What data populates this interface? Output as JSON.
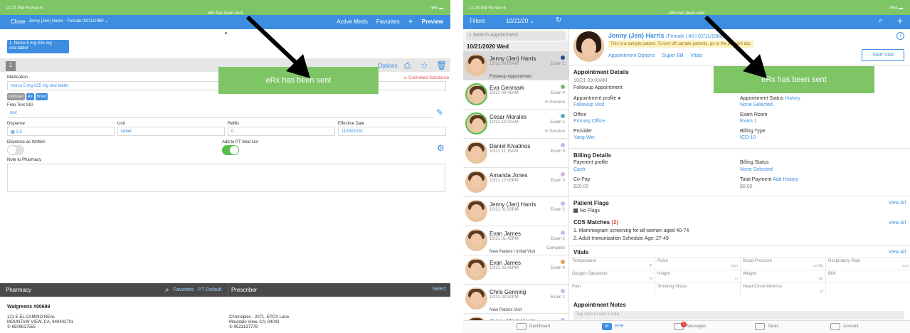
{
  "left": {
    "status": {
      "time": "12:21 PM  Fri Nov 6",
      "center": "eRx has been sent",
      "battery": "76%"
    },
    "nav": {
      "close": "Close",
      "patient": "Jenny (Jen) Harris - Female 02/11/1980",
      "active_meds": "Active Meds",
      "favorites": "Favorites",
      "plus": "+",
      "preview": "Preview"
    },
    "med_chip": {
      "line1": "1. Norco 5 mg-325 mg",
      "line2": "oral tablet"
    },
    "row_number": "1",
    "options": "Options",
    "medication_label": "Medication",
    "controlled": "Controlled Substance",
    "medication_value": "Norco 5 mg-325 mg oral tablet",
    "tags": [
      "Unknown",
      "RX",
      "Brand"
    ],
    "sig_label": "Free Text SIG",
    "sig_value": "test",
    "dispense_label": "Dispense",
    "dispense_value": "1.0",
    "unit_label": "Unit",
    "unit_value": "tablet",
    "refills_label": "Refills",
    "refills_value": "0",
    "effective_label": "Effective Date",
    "effective_value": "11/06/2020",
    "daw_label": "Dispense as Written",
    "daw_on": false,
    "addpt_label": "Add to PT Med List",
    "addpt_on": true,
    "note_label": "Note to Pharmacy",
    "banner": "eRx has been sent",
    "pharmacy": {
      "title": "Pharmacy",
      "favorites": "Favorites",
      "pt_default": "PT Default",
      "prescriber": "Prescriber",
      "select": "Select"
    },
    "pharmacy_name": "Walgreens #00689",
    "pharmacy_addr1": "121 E EL CAMINO REAL",
    "pharmacy_addr2": "MOUNTAIN VIEW, CA, 940402701",
    "pharmacy_phone": "6509617555",
    "prescriber_addr1": "Chronoplex - 2071, EPCS Lane",
    "prescriber_addr2": "Mountain View, CA, 94043",
    "prescriber_phone": "9523137778"
  },
  "right": {
    "status": {
      "time": "12:29 PM  Fri Nov 6",
      "center": "eRx has been sent",
      "battery": "76%"
    },
    "nav": {
      "filters": "Filters",
      "date": "10/21/20",
      "plus": "+"
    },
    "search_placeholder": "Search Appointment",
    "date_header": "10/21/2020 Wed",
    "appointments": [
      {
        "name": "Jenny (Jen) Harris",
        "time": "10/21 09:00AM",
        "exam": "Exam 1",
        "status": "",
        "type": "Followup Appointment",
        "dot": "#2a4a8a"
      },
      {
        "name": "Eva Genmark",
        "time": "10/21 09:45AM",
        "exam": "Exam 4",
        "status": "In Session",
        "type": "",
        "dot": "#7ab86a"
      },
      {
        "name": "Cesar Morales",
        "time": "10/21 10:30AM",
        "exam": "Exam 1",
        "status": "In Session",
        "type": "",
        "dot": "#5aa8b8"
      },
      {
        "name": "Daniel Kivatinos",
        "time": "10/21 11:15AM",
        "exam": "Exam 3",
        "status": "",
        "type": "",
        "dot": "#c9b8e8"
      },
      {
        "name": "Amanda Jones",
        "time": "10/21 12:00PM",
        "exam": "Exam 3",
        "status": "",
        "type": "",
        "dot": "#c9b8e8"
      },
      {
        "name": "Jenny (Jen) Harris",
        "time": "10/21 01:00PM",
        "exam": "Exam 2",
        "status": "",
        "type": "",
        "dot": "#c9b8e8"
      },
      {
        "name": "Evan James",
        "time": "10/21 01:45PM",
        "exam": "Exam 1",
        "status": "Complete",
        "type": "New Patient / Initial Visit",
        "dot": "#c9b8e8"
      },
      {
        "name": "Evan James",
        "time": "10/21 02:45PM",
        "exam": "Exam 4",
        "status": "",
        "type": "",
        "dot": "#e0a060"
      },
      {
        "name": "Chris Genning",
        "time": "10/21 03:30PM",
        "exam": "Exam 1",
        "status": "",
        "type": "New Patient Visit",
        "dot": "#c9b8e8"
      },
      {
        "name": "Jenny (Jen) Harris",
        "time": "",
        "exam": "",
        "status": "",
        "type": "",
        "dot": "#c9b8e8"
      }
    ],
    "patient": {
      "name": "Jenny (Jen) Harris",
      "sub": "(Female | 40 | 02/11/1980)",
      "sample": "This is a sample patient. To turn off sample patients, go to the account tab.",
      "links": [
        "Appointment Options",
        "Super Bill",
        "Vitals"
      ],
      "start_visit": "Start Visit"
    },
    "appt_details": {
      "title": "Appointment Details",
      "datetime": "10/21 09:00AM",
      "type": "Followup Appointment",
      "profile_label": "Appointment profile",
      "profile_value": "Followup Visit",
      "status_label": "Appointment Status",
      "history": "History",
      "status_value": "None Selected",
      "office_label": "Office",
      "office_value": "Primary Office",
      "room_label": "Exam Room",
      "room_value": "Exam 1",
      "provider_label": "Provider",
      "provider_value": "Yang Wei",
      "billing_type_label": "Billing Type",
      "billing_type_value": "ICD-10"
    },
    "billing": {
      "title": "Billing Details",
      "payment_label": "Payment profile",
      "payment_value": "Cash",
      "status_label": "Billing Status",
      "status_value": "None Selected",
      "copay_label": "Co-Pay",
      "copay_value": "$20.00",
      "total_label": "Total Payment",
      "add": "Add",
      "history": "History",
      "total_value": "$0.00"
    },
    "flags": {
      "title": "Patient Flags",
      "view_all": "View All",
      "value": "No Flags"
    },
    "cds": {
      "title": "CDS Matches",
      "count": "(2)",
      "view_all": "View All",
      "items": [
        "1. Mammogram screening for all women aged 40-74",
        "2. Adult Immunization Schedule Age: 27-49"
      ]
    },
    "vitals": {
      "title": "Vitals",
      "view_all": "View All",
      "rows": [
        [
          {
            "n": "Temperature",
            "u": "°F"
          },
          {
            "n": "Pulse",
            "u": "bpm"
          },
          {
            "n": "Blood Pressure",
            "u": "mmHg"
          },
          {
            "n": "Respiratory Rate",
            "u": "rpm"
          }
        ],
        [
          {
            "n": "Oxygen Saturation",
            "u": "%"
          },
          {
            "n": "Height",
            "u": "in"
          },
          {
            "n": "Weight",
            "u": "lbs"
          },
          {
            "n": "BMI",
            "u": ""
          }
        ],
        [
          {
            "n": "Pain",
            "u": ""
          },
          {
            "n": "Smoking Status",
            "u": ""
          },
          {
            "n": "Head Circumference",
            "u": "in"
          },
          {
            "n": "",
            "u": ""
          }
        ]
      ]
    },
    "notes": {
      "title": "Appointment Notes",
      "placeholder": "Tap here to add a note"
    },
    "banner": "eRx has been sent",
    "tabs": [
      {
        "label": "Dashboard",
        "icon": "dashboard-icon"
      },
      {
        "label": "EHR",
        "icon": "ehr-icon",
        "active": true,
        "mark": "dr"
      },
      {
        "label": "Messages",
        "icon": "messages-icon",
        "badge": "1"
      },
      {
        "label": "Tasks",
        "icon": "tasks-icon"
      },
      {
        "label": "Account",
        "icon": "account-icon"
      }
    ]
  },
  "colors": {
    "green": "#7dc565",
    "blue": "#3d8ee0",
    "dark": "#4a4a4a"
  }
}
